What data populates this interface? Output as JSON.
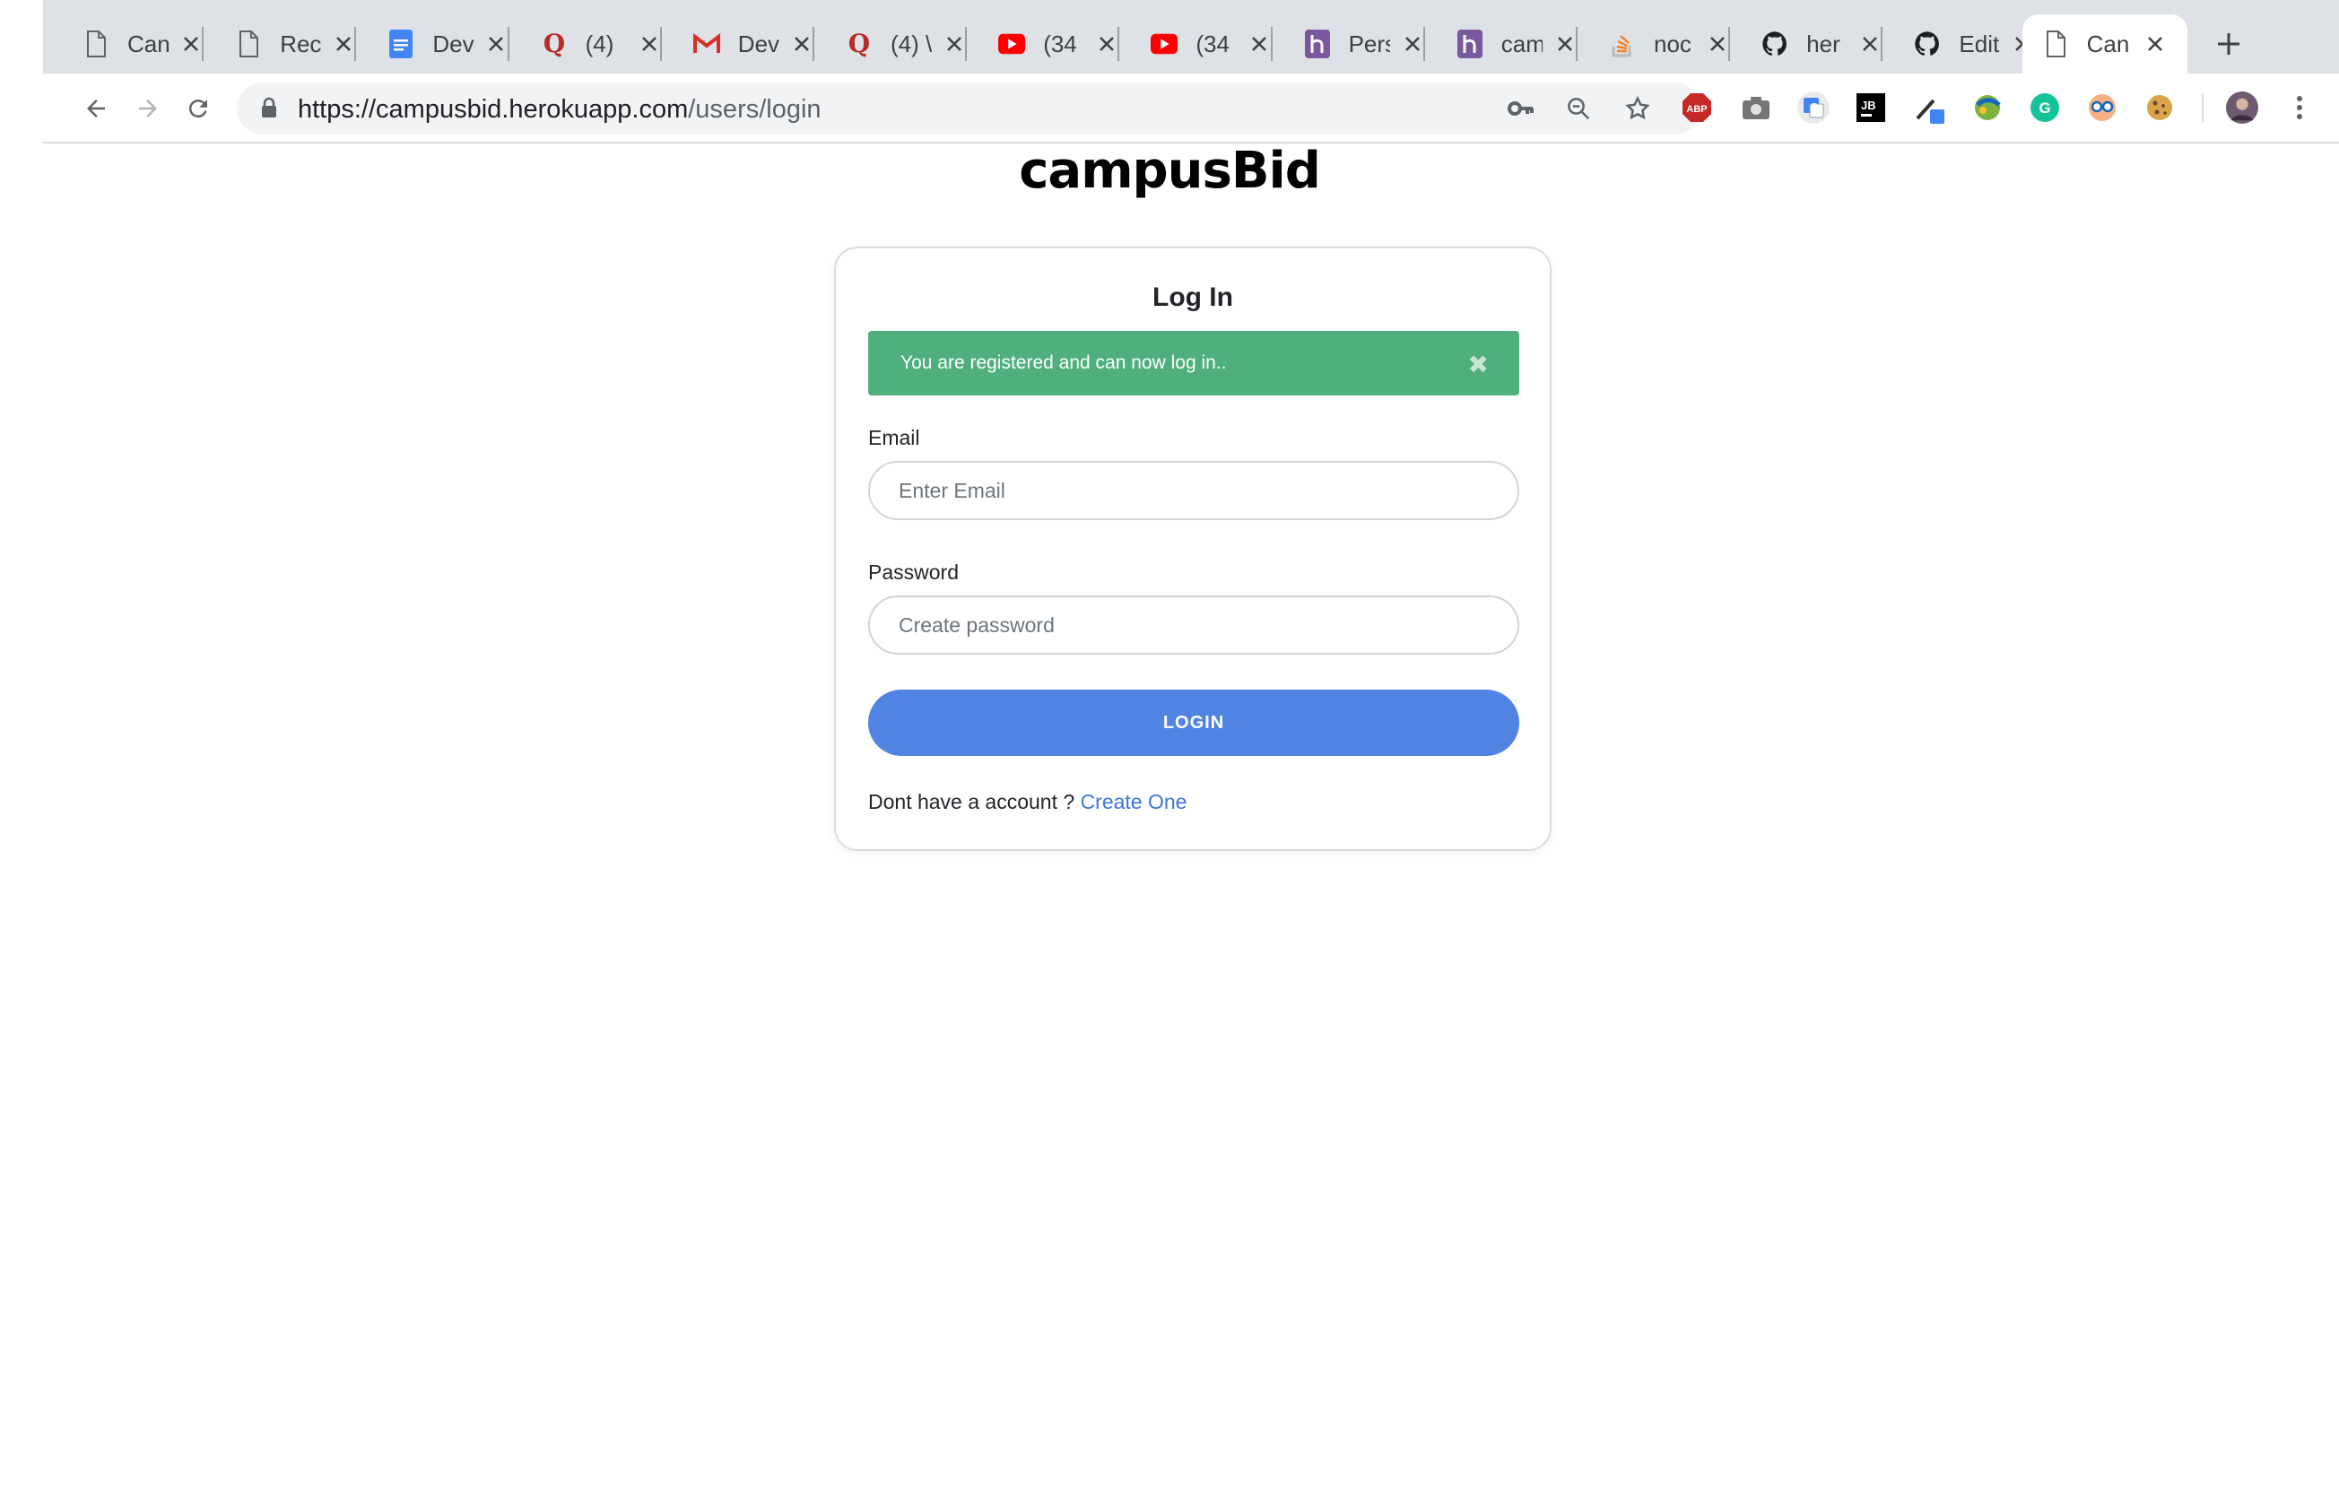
{
  "browser": {
    "tabs": [
      {
        "title": "Can",
        "icon": "page-icon"
      },
      {
        "title": "Rec",
        "icon": "page-icon"
      },
      {
        "title": "Dev",
        "icon": "google-docs-icon"
      },
      {
        "title": "(4)",
        "icon": "quora-icon"
      },
      {
        "title": "Dev",
        "icon": "gmail-icon"
      },
      {
        "title": "(4) \\",
        "icon": "quora-icon"
      },
      {
        "title": "(34",
        "icon": "youtube-icon"
      },
      {
        "title": "(34",
        "icon": "youtube-icon"
      },
      {
        "title": "Pers",
        "icon": "heroku-icon"
      },
      {
        "title": "cam",
        "icon": "heroku-icon"
      },
      {
        "title": "noc",
        "icon": "stackoverflow-icon"
      },
      {
        "title": "her",
        "icon": "github-icon"
      },
      {
        "title": "Edit",
        "icon": "github-icon"
      },
      {
        "title": "Can",
        "icon": "page-icon",
        "active": true
      }
    ],
    "url_host": "https://campusbid.herokuapp.com",
    "url_path": "/users/login",
    "colors": {
      "accent": "#5083e2",
      "success": "#4fb07e",
      "link": "#3c76d6"
    }
  },
  "page": {
    "brand": "campusBid",
    "card_title": "Log In",
    "alert_message": "You are registered and can now log in..",
    "alert_close": "✖",
    "email_label": "Email",
    "email_placeholder": "Enter Email",
    "password_label": "Password",
    "password_placeholder": "Create password",
    "login_button": "LOGIN",
    "footer_text": "Dont have a account ? ",
    "footer_link": "Create One"
  }
}
